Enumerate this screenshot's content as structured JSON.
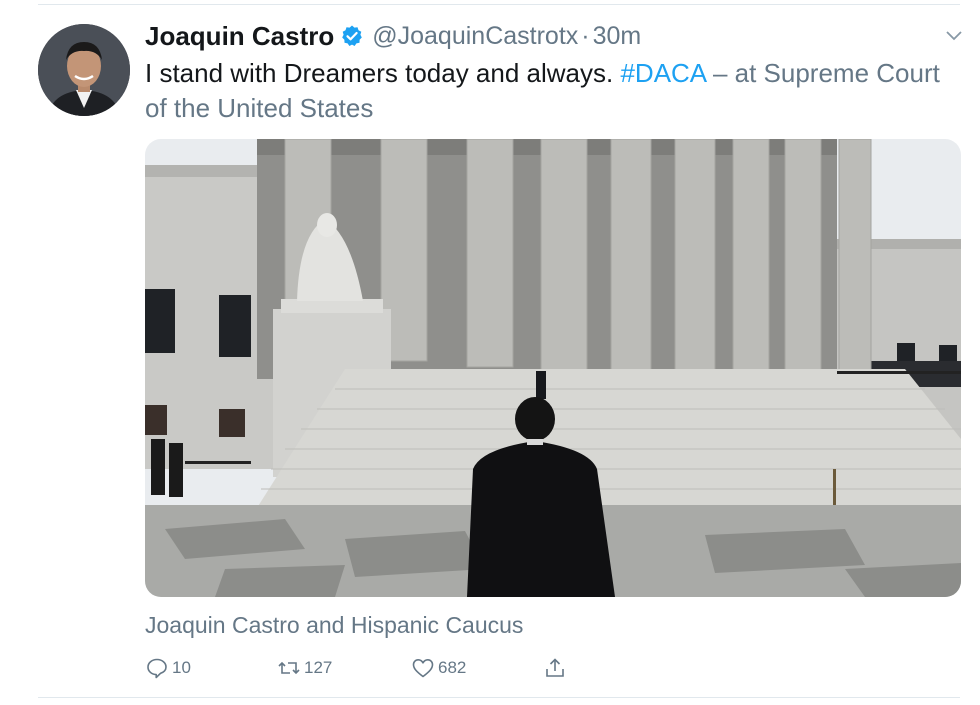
{
  "tweet": {
    "author": {
      "name": "Joaquin Castro",
      "handle": "@JoaquinCastrotx",
      "verified": true
    },
    "separator": "·",
    "time": "30m",
    "text_before": "I stand with Dreamers today and always. ",
    "hashtag": "#DACA",
    "location": " – at Supreme Court of the United States",
    "tagged": "Joaquin Castro and Hispanic Caucus",
    "actions": {
      "reply_count": "10",
      "retweet_count": "127",
      "like_count": "682"
    }
  },
  "icons": {
    "verified": "verified-badge-icon",
    "menu": "chevron-down-icon",
    "reply": "reply-icon",
    "retweet": "retweet-icon",
    "like": "heart-icon",
    "share": "share-icon"
  },
  "colors": {
    "text": "#14171a",
    "secondary": "#657786",
    "link": "#1da1f2",
    "divider": "#e1e8ed"
  }
}
